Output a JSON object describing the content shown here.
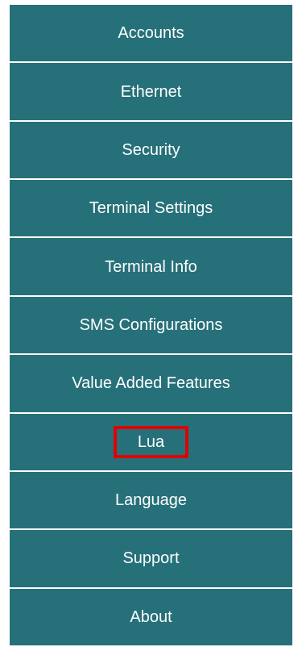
{
  "menu": {
    "items": [
      {
        "label": "Accounts"
      },
      {
        "label": "Ethernet"
      },
      {
        "label": "Security"
      },
      {
        "label": "Terminal Settings"
      },
      {
        "label": "Terminal Info"
      },
      {
        "label": "SMS Configurations"
      },
      {
        "label": "Value Added Features"
      },
      {
        "label": "Lua"
      },
      {
        "label": "Language"
      },
      {
        "label": "Support"
      },
      {
        "label": "About"
      }
    ],
    "highlighted_item": "Lua",
    "colors": {
      "item_background": "#26707a",
      "text": "#ffffff",
      "separator": "#ffffff",
      "highlight_border": "#e00000"
    }
  }
}
